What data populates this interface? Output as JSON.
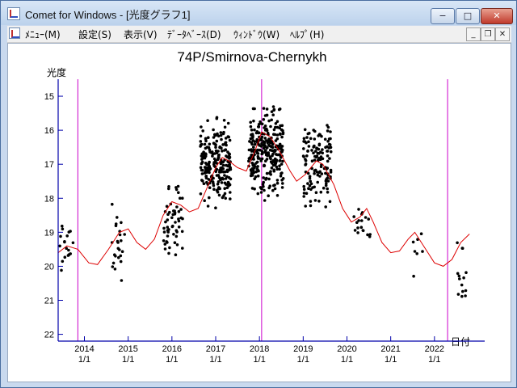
{
  "window": {
    "title": "Comet for Windows - [光度グラフ1]",
    "buttons": {
      "minimize": "−",
      "maximize": "□",
      "close": "✕"
    }
  },
  "menu": {
    "items": [
      "ﾒﾆｭｰ(M)",
      "設定(S)",
      "表示(V)",
      "ﾃﾞｰﾀﾍﾞｰｽ(D)",
      "ｳｨﾝﾄﾞｳ(W)",
      "ﾍﾙﾌﾟ(H)"
    ],
    "mdi_buttons": {
      "minimize": "_",
      "restore": "❐",
      "close": "✕"
    }
  },
  "colors": {
    "axis": "#0000aa",
    "markers": "#cc00cc",
    "curve": "#dd0000",
    "points": "#000000"
  },
  "chart_data": {
    "type": "scatter",
    "title": "74P/Smirnova-Chernykh",
    "ylabel": "光度",
    "xlabel": "日付",
    "y_inverted": true,
    "ylim": [
      22.2,
      14.5
    ],
    "xlim": [
      2013.4,
      2023.0
    ],
    "y_ticks": [
      15,
      16,
      17,
      18,
      19,
      20,
      21,
      22
    ],
    "x_ticks": [
      {
        "year": "2014",
        "day": "1/1",
        "value": 2014
      },
      {
        "year": "2015",
        "day": "1/1",
        "value": 2015
      },
      {
        "year": "2016",
        "day": "1/1",
        "value": 2016
      },
      {
        "year": "2017",
        "day": "1/1",
        "value": 2017
      },
      {
        "year": "2018",
        "day": "1/1",
        "value": 2018
      },
      {
        "year": "2019",
        "day": "1/1",
        "value": 2019
      },
      {
        "year": "2020",
        "day": "1/1",
        "value": 2020
      },
      {
        "year": "2021",
        "day": "1/1",
        "value": 2021
      },
      {
        "year": "2022",
        "day": "1/1",
        "value": 2022
      }
    ],
    "vertical_markers": [
      2013.85,
      2018.05,
      2022.3
    ],
    "curve": [
      [
        2013.4,
        19.6
      ],
      [
        2013.6,
        19.4
      ],
      [
        2013.85,
        19.5
      ],
      [
        2014.1,
        19.9
      ],
      [
        2014.3,
        19.95
      ],
      [
        2014.55,
        19.5
      ],
      [
        2014.8,
        19.0
      ],
      [
        2015.0,
        18.9
      ],
      [
        2015.2,
        19.3
      ],
      [
        2015.4,
        19.5
      ],
      [
        2015.6,
        19.2
      ],
      [
        2015.8,
        18.5
      ],
      [
        2016.0,
        18.1
      ],
      [
        2016.2,
        18.2
      ],
      [
        2016.4,
        18.4
      ],
      [
        2016.6,
        18.3
      ],
      [
        2016.8,
        17.7
      ],
      [
        2017.0,
        17.1
      ],
      [
        2017.15,
        16.8
      ],
      [
        2017.3,
        16.9
      ],
      [
        2017.5,
        17.1
      ],
      [
        2017.7,
        17.2
      ],
      [
        2017.9,
        16.6
      ],
      [
        2018.05,
        16.05
      ],
      [
        2018.25,
        16.2
      ],
      [
        2018.45,
        16.6
      ],
      [
        2018.7,
        17.2
      ],
      [
        2018.85,
        17.5
      ],
      [
        2019.05,
        17.3
      ],
      [
        2019.3,
        16.9
      ],
      [
        2019.45,
        17.0
      ],
      [
        2019.7,
        17.6
      ],
      [
        2019.9,
        18.3
      ],
      [
        2020.1,
        18.7
      ],
      [
        2020.3,
        18.55
      ],
      [
        2020.45,
        18.3
      ],
      [
        2020.6,
        18.7
      ],
      [
        2020.8,
        19.3
      ],
      [
        2021.0,
        19.6
      ],
      [
        2021.2,
        19.55
      ],
      [
        2021.4,
        19.2
      ],
      [
        2021.55,
        19.0
      ],
      [
        2021.8,
        19.5
      ],
      [
        2022.0,
        19.9
      ],
      [
        2022.2,
        20.0
      ],
      [
        2022.4,
        19.8
      ],
      [
        2022.6,
        19.3
      ],
      [
        2022.8,
        19.05
      ]
    ],
    "point_clusters": [
      {
        "x": [
          2013.4,
          2013.75
        ],
        "y": [
          18.2,
          20.5
        ],
        "n": 18
      },
      {
        "x": [
          2014.6,
          2014.95
        ],
        "y": [
          17.8,
          20.8
        ],
        "n": 24
      },
      {
        "x": [
          2015.8,
          2016.25
        ],
        "y": [
          17.2,
          20.1
        ],
        "n": 55
      },
      {
        "x": [
          2016.65,
          2017.35
        ],
        "y": [
          15.4,
          18.6
        ],
        "n": 230
      },
      {
        "x": [
          2017.75,
          2018.55
        ],
        "y": [
          14.9,
          18.3
        ],
        "n": 280
      },
      {
        "x": [
          2019.0,
          2019.65
        ],
        "y": [
          15.0,
          18.7
        ],
        "n": 140
      },
      {
        "x": [
          2020.15,
          2020.55
        ],
        "y": [
          18.0,
          19.6
        ],
        "n": 18
      },
      {
        "x": [
          2021.5,
          2021.75
        ],
        "y": [
          18.4,
          21.2
        ],
        "n": 7
      },
      {
        "x": [
          2022.5,
          2022.75
        ],
        "y": [
          18.8,
          21.5
        ],
        "n": 14
      }
    ]
  }
}
